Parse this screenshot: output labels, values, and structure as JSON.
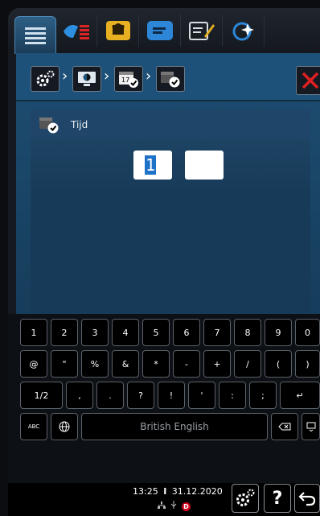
{
  "tabs": [
    {
      "name": "recipes-list-icon"
    },
    {
      "name": "dishes-icon"
    },
    {
      "name": "chef-hat-icon"
    },
    {
      "name": "chat-bubble-icon"
    },
    {
      "name": "edit-note-icon"
    },
    {
      "name": "clean-cycle-icon"
    }
  ],
  "breadcrumb": [
    {
      "name": "settings-icon"
    },
    {
      "name": "display-icon"
    },
    {
      "name": "date-icon",
      "text": "17"
    },
    {
      "name": "time-check-icon"
    }
  ],
  "section": {
    "title": "Tijd"
  },
  "time": {
    "hours": "1",
    "minutes": ""
  },
  "keyboard": {
    "row1": [
      "1",
      "2",
      "3",
      "4",
      "5",
      "6",
      "7",
      "8",
      "9",
      "0"
    ],
    "row2": [
      "@",
      "\"",
      "%",
      "&",
      "*",
      "-",
      "+",
      "/",
      "(",
      ")"
    ],
    "row3": [
      "1/2",
      ",",
      ".",
      "?",
      "!",
      "'",
      ":",
      ";",
      "↵"
    ],
    "row4": {
      "abc": "ABC",
      "language": "British English"
    }
  },
  "status": {
    "time": "13:25",
    "separator": "I",
    "date": "31.12.2020",
    "help": "?",
    "brand_badge": "D"
  },
  "colors": {
    "accent": "#1e73c8",
    "close": "#e02020",
    "panel": "#1d5179"
  }
}
